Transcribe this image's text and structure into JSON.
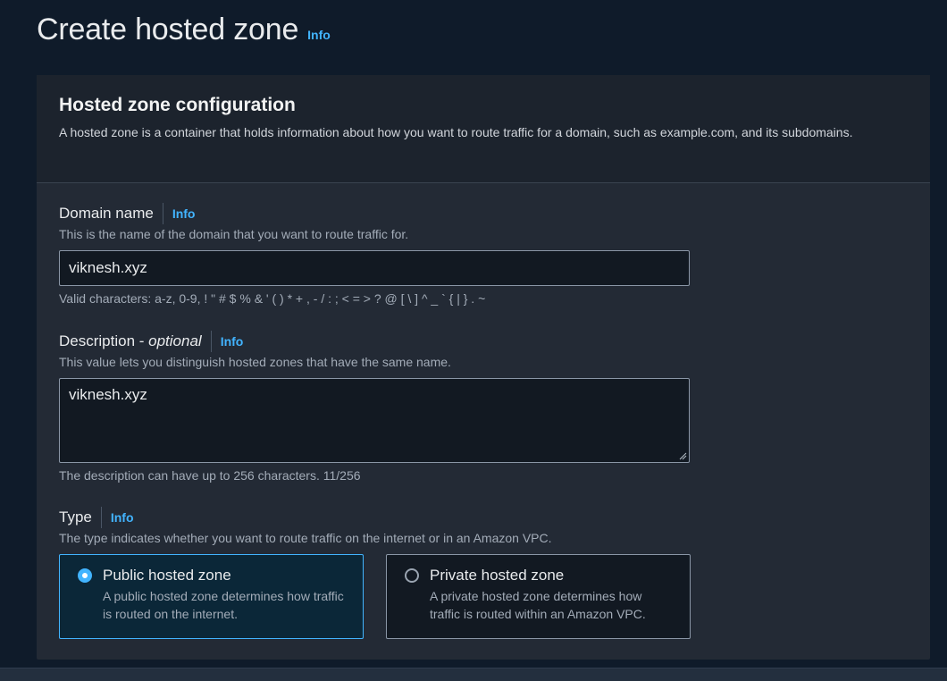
{
  "header": {
    "title": "Create hosted zone",
    "info_label": "Info"
  },
  "config": {
    "title": "Hosted zone configuration",
    "description": "A hosted zone is a container that holds information about how you want to route traffic for a domain, such as example.com, and its subdomains."
  },
  "domain": {
    "label": "Domain name",
    "info_label": "Info",
    "help": "This is the name of the domain that you want to route traffic for.",
    "value": "viknesh.xyz",
    "hint": "Valid characters: a-z, 0-9, ! \" # $ % & ' ( ) * + , - / : ; < = > ? @ [ \\ ] ^ _ ` { | } . ~"
  },
  "description_field": {
    "label": "Description - ",
    "label_optional": "optional",
    "info_label": "Info",
    "help": "This value lets you distinguish hosted zones that have the same name.",
    "value": "viknesh.xyz",
    "hint": "The description can have up to 256 characters. 11/256"
  },
  "type": {
    "label": "Type",
    "info_label": "Info",
    "help": "The type indicates whether you want to route traffic on the internet or in an Amazon VPC.",
    "options": [
      {
        "title": "Public hosted zone",
        "description": "A public hosted zone determines how traffic is routed on the internet.",
        "selected": true
      },
      {
        "title": "Private hosted zone",
        "description": "A private hosted zone determines how traffic is routed within an Amazon VPC.",
        "selected": false
      }
    ]
  },
  "colors": {
    "accent": "#42b4ff",
    "panel": "#232a35",
    "background": "#0f1b2a"
  }
}
